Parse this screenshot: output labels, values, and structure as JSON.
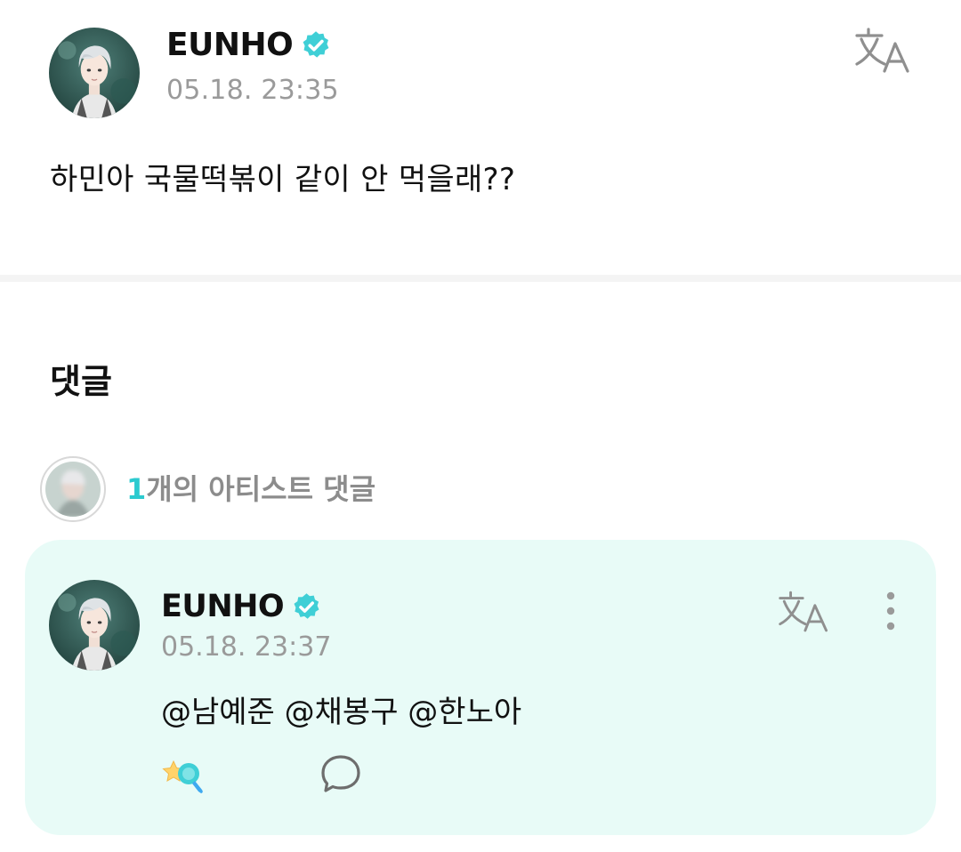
{
  "post": {
    "author": "EUNHO",
    "timestamp": "05.18. 23:35",
    "body": "하민아 국물떡볶이 같이 안 먹을래??"
  },
  "comments_section": {
    "title": "댓글",
    "artist_summary": {
      "count": "1",
      "label": "개의 아티스트 댓글"
    },
    "comments": [
      {
        "author": "EUNHO",
        "timestamp": "05.18. 23:37",
        "body": "@남예준 @채봉구 @한노아"
      }
    ]
  },
  "icons": {
    "verified": "verified-badge-icon",
    "translate": "translate-icon",
    "more": "more-vertical-icon",
    "cheer": "cheer-star-icon",
    "reply": "speech-bubble-icon"
  },
  "colors": {
    "accent": "#2ccacf",
    "card_background": "#e8fbf7",
    "timestamp": "#9a9a9a",
    "verified_badge": "#3fcfd6"
  }
}
